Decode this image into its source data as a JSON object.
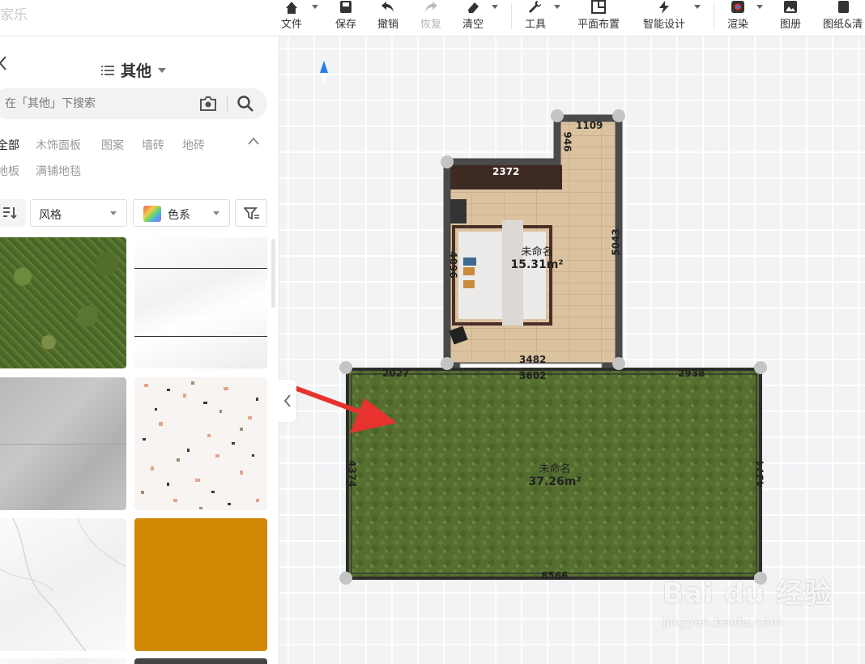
{
  "app": {
    "brand": "家乐"
  },
  "toolbar": {
    "items": [
      {
        "label": "文件",
        "icon": "home-icon",
        "caret": true
      },
      {
        "label": "保存",
        "icon": "save-icon"
      },
      {
        "label": "撤销",
        "icon": "undo-icon"
      },
      {
        "label": "恢复",
        "icon": "redo-icon",
        "disabled": true
      },
      {
        "label": "清空",
        "icon": "eraser-icon",
        "caret": true
      },
      {
        "label": "工具",
        "icon": "wrench-icon",
        "caret": true
      },
      {
        "label": "平面布置",
        "icon": "floorplan-icon"
      },
      {
        "label": "智能设计",
        "icon": "smart-design-icon",
        "caret": true
      },
      {
        "label": "渲染",
        "icon": "render-icon",
        "caret": true
      },
      {
        "label": "图册",
        "icon": "album-icon"
      },
      {
        "label": "图纸&清",
        "icon": "drawings-icon"
      }
    ]
  },
  "panel": {
    "title": "其他",
    "search_placeholder": "在「其他」下搜索",
    "filters_row1": [
      "全部",
      "木饰面板",
      "图案",
      "墙砖",
      "地砖"
    ],
    "filters_row2": [
      "地板",
      "满铺地毯"
    ],
    "style_dropdown": "风格",
    "color_dropdown": "色系",
    "materials": [
      "grass",
      "white-marble-lines",
      "grey-stone",
      "terrazzo",
      "white-marble",
      "orange",
      "dark-stone"
    ]
  },
  "plan": {
    "rooms": [
      {
        "name": "未命名",
        "area": "15.31m²"
      },
      {
        "name": "未命名",
        "area": "37.26m²"
      }
    ],
    "dimensions": {
      "top_notch": "1109",
      "notch_side": "946",
      "upper_top": "2372",
      "upper_left": "4096",
      "upper_right": "5043",
      "upper_bottom_inner": "3482",
      "lower_top_left": "2027",
      "lower_top_mid": "3602",
      "lower_top_right": "2938",
      "lower_left": "4374",
      "lower_right": "4374",
      "lower_bottom": "8566"
    }
  },
  "watermark": {
    "logo": "Bai du 经验",
    "url": "jingyan.baidu.com"
  },
  "colors": {
    "accent_red": "#e8322d",
    "grass": "#556f30",
    "wall": "#4a4a4a",
    "floor": "#d9bf9b"
  }
}
